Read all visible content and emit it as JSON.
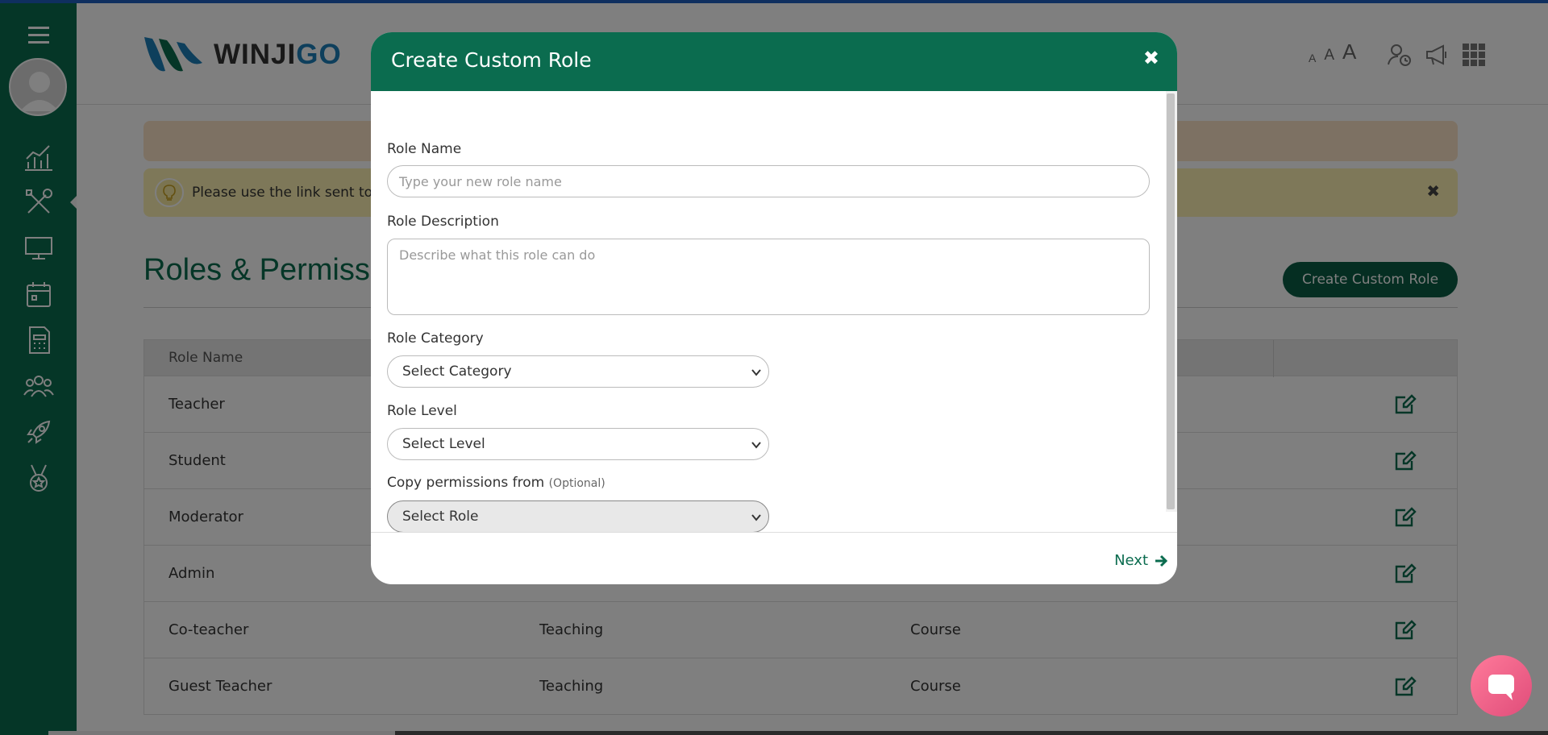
{
  "header": {
    "logo_text_a": "WINJI",
    "logo_text_b": "GO",
    "font_small": "A",
    "font_medium": "A",
    "font_large": "A"
  },
  "sidebar": {
    "items": [
      {
        "icon": "menu-icon"
      },
      {
        "icon": "analytics-icon"
      },
      {
        "icon": "tools-icon",
        "active": true
      },
      {
        "icon": "monitor-icon"
      },
      {
        "icon": "calendar-icon"
      },
      {
        "icon": "calculator-document-icon"
      },
      {
        "icon": "users-group-icon"
      },
      {
        "icon": "rocket-icon"
      },
      {
        "icon": "medal-icon"
      }
    ]
  },
  "notice": {
    "text": "Please use the link sent to y"
  },
  "page": {
    "title": "Roles & Permissic",
    "create_button": "Create Custom Role"
  },
  "table": {
    "header_role_name": "Role Name",
    "rows": [
      {
        "name": "Teacher",
        "category": "",
        "level": ""
      },
      {
        "name": "Student",
        "category": "",
        "level": ""
      },
      {
        "name": "Moderator",
        "category": "",
        "level": ""
      },
      {
        "name": "Admin",
        "category": "",
        "level": ""
      },
      {
        "name": "Co-teacher",
        "category": "Teaching",
        "level": "Course"
      },
      {
        "name": "Guest Teacher",
        "category": "Teaching",
        "level": "Course"
      }
    ]
  },
  "modal": {
    "title": "Create Custom Role",
    "role_name_label": "Role Name",
    "role_name_placeholder": "Type your new role name",
    "role_description_label": "Role Description",
    "role_description_placeholder": "Describe what this role can do",
    "role_category_label": "Role Category",
    "role_category_value": "Select Category",
    "role_level_label": "Role Level",
    "role_level_value": "Select Level",
    "copy_label": "Copy permissions from",
    "copy_optional": "(Optional)",
    "copy_value": "Select Role",
    "next_label": "Next"
  },
  "colors": {
    "brand_green": "#0b6c4f",
    "accent_blue": "#1d7fb8",
    "chat_pink": "#e04d7a"
  }
}
